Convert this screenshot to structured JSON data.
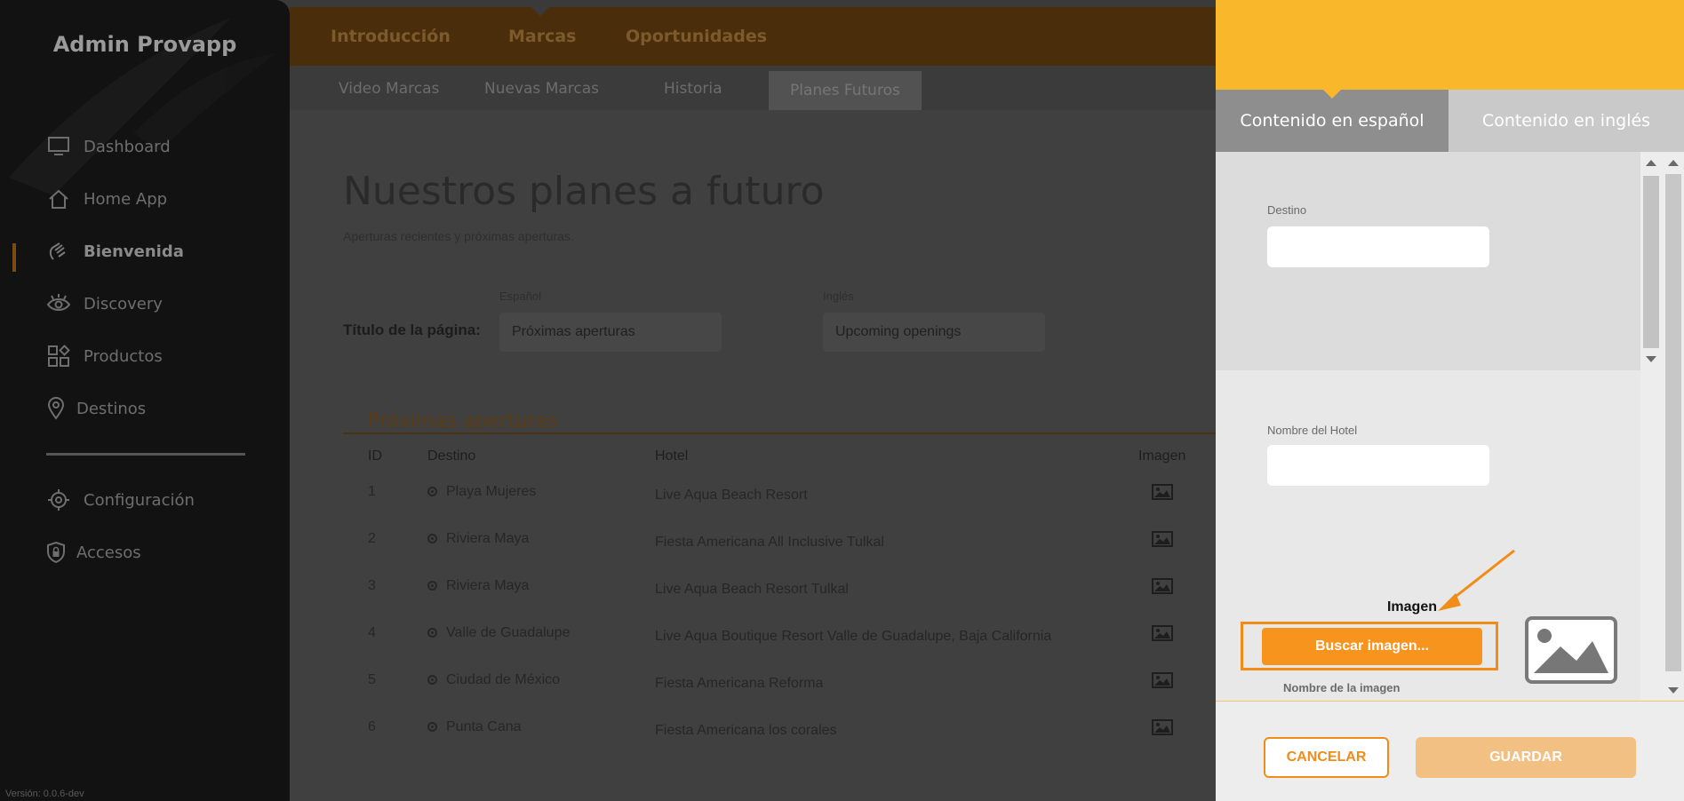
{
  "sidebar": {
    "brand": "Admin Provapp",
    "items": [
      {
        "label": "Dashboard",
        "icon": "monitor-icon"
      },
      {
        "label": "Home App",
        "icon": "home-icon"
      },
      {
        "label": "Bienvenida",
        "icon": "wave-hand-icon"
      },
      {
        "label": "Discovery",
        "icon": "eye-icon"
      },
      {
        "label": "Productos",
        "icon": "grid-shapes-icon"
      },
      {
        "label": "Destinos",
        "icon": "map-pin-icon"
      },
      {
        "label": "Configuración",
        "icon": "gear-icon"
      },
      {
        "label": "Accesos",
        "icon": "shield-lock-icon"
      }
    ],
    "version": "Versión: 0.0.6-dev"
  },
  "main": {
    "tabs": [
      "Introducción",
      "Marcas",
      "Oportunidades"
    ],
    "subtabs": [
      "Video Marcas",
      "Nuevas Marcas",
      "Historia",
      "Planes Futuros"
    ],
    "title": "Nuestros planes a futuro",
    "subtitle": "Aperturas recientes y próximas aperturas.",
    "form": {
      "label": "Título de la página:",
      "es_label": "Español",
      "en_label": "Inglés",
      "es_value": "Próximas aperturas",
      "en_value": "Upcoming openings"
    },
    "section_title": "Próximas aperturas",
    "table": {
      "headers": [
        "ID",
        "Destino",
        "Hotel",
        "Imagen"
      ],
      "rows": [
        {
          "id": "1",
          "destino": "Playa Mujeres",
          "hotel": "Live Aqua Beach Resort"
        },
        {
          "id": "2",
          "destino": "Riviera Maya",
          "hotel": "Fiesta Americana All Inclusive Tulkal"
        },
        {
          "id": "3",
          "destino": "Riviera Maya",
          "hotel": "Live Aqua Beach Resort Tulkal"
        },
        {
          "id": "4",
          "destino": "Valle de Guadalupe",
          "hotel": "Live Aqua Boutique Resort Valle de Guadalupe, Baja California"
        },
        {
          "id": "5",
          "destino": "Ciudad de México",
          "hotel": "Fiesta Americana Reforma"
        },
        {
          "id": "6",
          "destino": "Punta Cana",
          "hotel": "Fiesta Americana los corales"
        }
      ]
    }
  },
  "panel": {
    "tab_es": "Contenido en español",
    "tab_en": "Contenido en inglés",
    "destino_label": "Destino",
    "hotel_label": "Nombre del Hotel",
    "imagen_label": "Imagen",
    "buscar_label": "Buscar imagen...",
    "image_name_label": "Nombre de la imagen",
    "cancel_label": "CANCELAR",
    "save_label": "GUARDAR"
  },
  "colors": {
    "accent": "#f7941d",
    "header": "#f9b82c",
    "sidebar_bg": "#121212"
  }
}
